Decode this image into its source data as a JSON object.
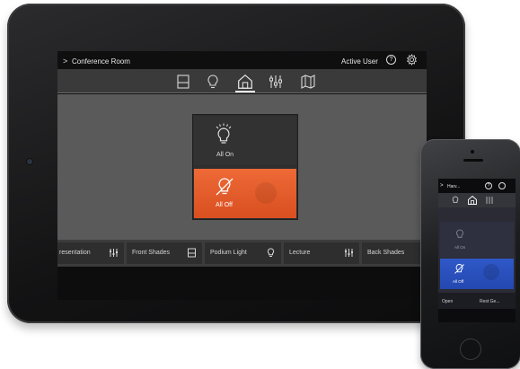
{
  "tablet": {
    "header": {
      "back_glyph": ">",
      "room": "Conference Room",
      "user": "Active User",
      "help": "?"
    },
    "tabs": [
      {
        "icon": "shade-icon",
        "active": false
      },
      {
        "icon": "lightbulb-icon",
        "active": false
      },
      {
        "icon": "home-icon",
        "active": true
      },
      {
        "icon": "sliders-icon",
        "active": false
      },
      {
        "icon": "map-icon",
        "active": false
      }
    ],
    "scene_panel": {
      "all_on": "All On",
      "all_off": "All Off"
    },
    "scenes": [
      {
        "label": "resentation",
        "icon": "sliders-icon"
      },
      {
        "label": "Front Shades",
        "icon": "shade-icon"
      },
      {
        "label": "Podium Light",
        "icon": "lightbulb-icon"
      },
      {
        "label": "Lecture",
        "icon": "sliders-icon"
      },
      {
        "label": "Back Shades",
        "icon": "shade-icon"
      }
    ],
    "colors": {
      "accent": "#e45a28",
      "content_bg": "#5a5a5a"
    }
  },
  "phone": {
    "header": {
      "back_glyph": ">",
      "title": "Harv...",
      "help": "?"
    },
    "scene_panel": {
      "all_on": "All On",
      "all_off": "All Off"
    },
    "scenes": [
      {
        "label": "Open"
      },
      {
        "label": "Rest Ge..."
      }
    ],
    "colors": {
      "accent": "#2c54c2"
    }
  }
}
